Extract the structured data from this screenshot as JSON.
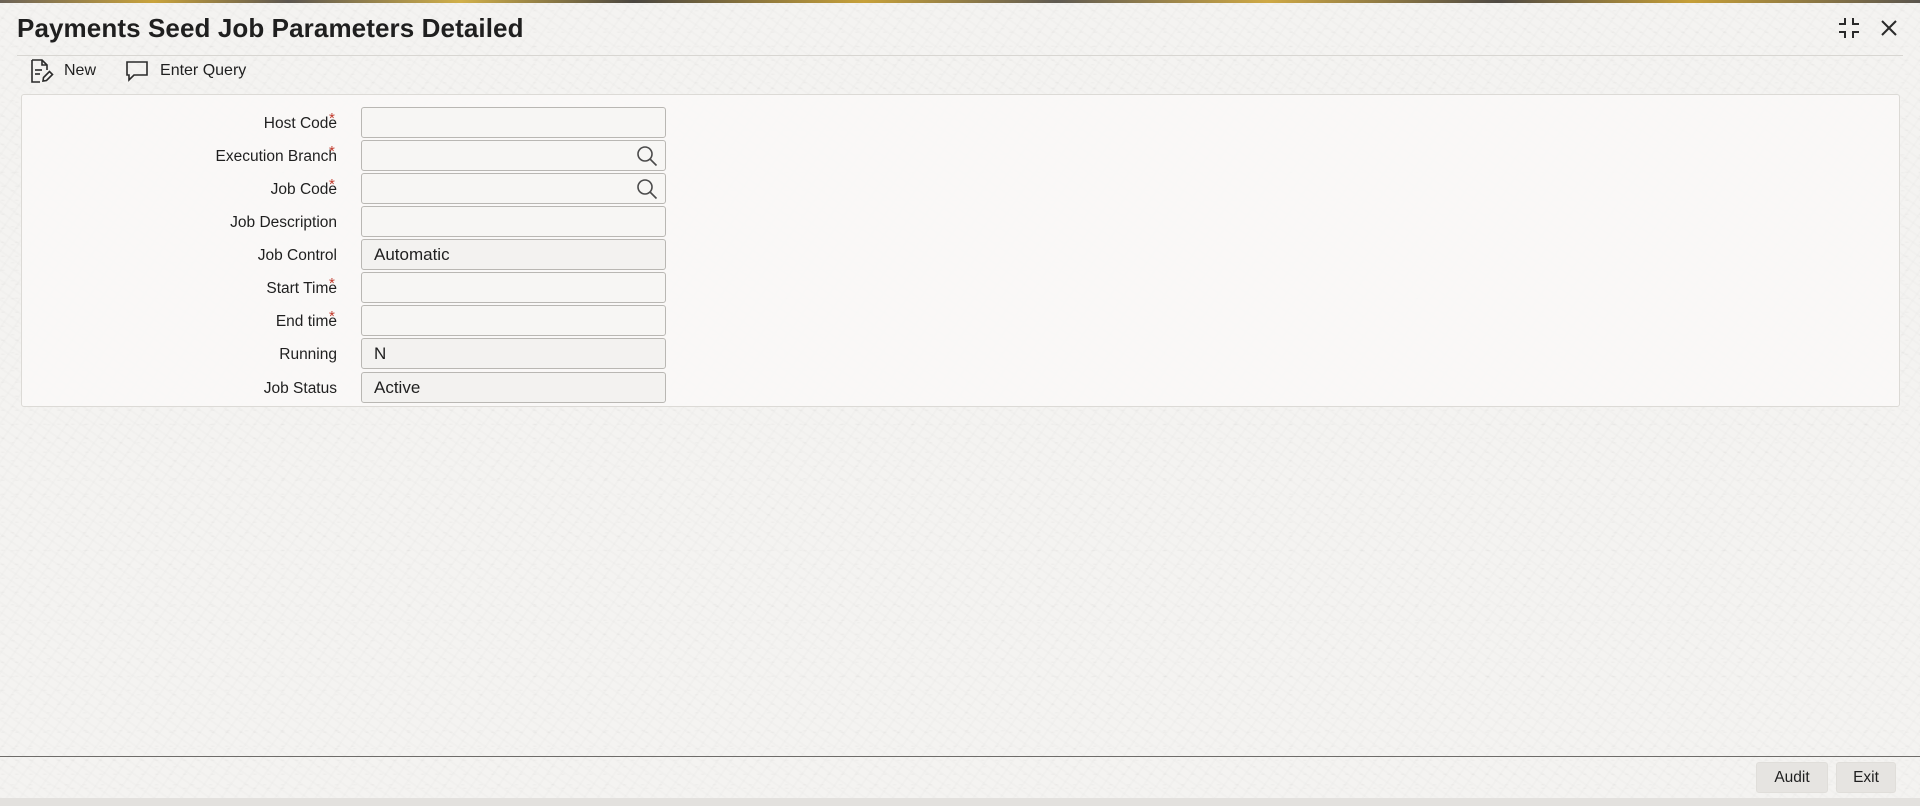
{
  "window": {
    "title": "Payments Seed Job Parameters Detailed",
    "controls": {
      "restore_icon": "collapse-icon",
      "close_icon": "close-icon"
    }
  },
  "toolbar": {
    "new_label": "New",
    "new_icon": "document-edit-icon",
    "enter_query_label": "Enter Query",
    "enter_query_icon": "speech-bubble-icon"
  },
  "form": {
    "host_code": {
      "label": "Host Code",
      "required": "*",
      "value": ""
    },
    "execution_branch": {
      "label": "Execution Branch",
      "required": "*",
      "value": "",
      "lookup_icon": "search-icon"
    },
    "job_code": {
      "label": "Job Code",
      "required": "*",
      "value": "",
      "lookup_icon": "search-icon"
    },
    "job_description": {
      "label": "Job Description",
      "value": ""
    },
    "job_control": {
      "label": "Job Control",
      "value": "Automatic"
    },
    "start_time": {
      "label": "Start Time",
      "required": "*",
      "value": ""
    },
    "end_time": {
      "label": "End time",
      "required": "*",
      "value": ""
    },
    "running": {
      "label": "Running",
      "value": "N"
    },
    "job_status": {
      "label": "Job Status",
      "value": "Active"
    }
  },
  "footer": {
    "audit_label": "Audit",
    "exit_label": "Exit"
  },
  "colors": {
    "required_marker": "#c0392b",
    "panel_background": "#faf9f7",
    "field_border": "#b9b7b3"
  }
}
